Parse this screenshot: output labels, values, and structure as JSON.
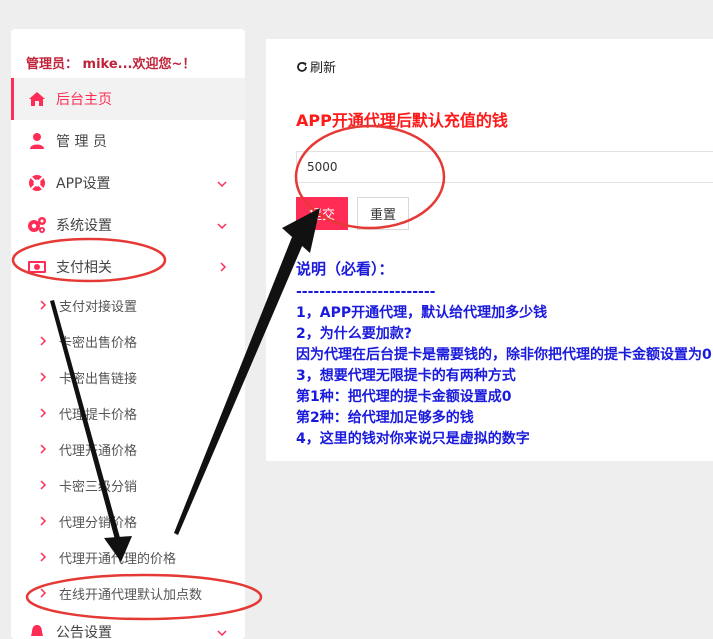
{
  "sidebar": {
    "admin_greeting": "管理员：  mike...欢迎您~！",
    "items": [
      {
        "label": "后台主页"
      },
      {
        "label": "管  理  员"
      },
      {
        "label": "APP设置"
      },
      {
        "label": "系统设置"
      },
      {
        "label": "支付相关"
      }
    ],
    "sub_items": [
      {
        "label": "支付对接设置"
      },
      {
        "label": "卡密出售价格"
      },
      {
        "label": "卡密出售链接"
      },
      {
        "label": "代理提卡价格"
      },
      {
        "label": "代理开通价格"
      },
      {
        "label": "卡密三级分销"
      },
      {
        "label": "代理分销价格"
      },
      {
        "label": "代理开通代理的价格"
      },
      {
        "label": "在线开通代理默认加点数"
      }
    ],
    "bottom_partial": "公告设置"
  },
  "main": {
    "refresh_label": "刷新",
    "field_title": "APP开通代理后默认充值的钱",
    "amount_value": "5000",
    "submit_label": "提交",
    "reset_label": "重置",
    "notes": [
      "说明（必看）：",
      "------------------------",
      "1，APP开通代理，默认给代理加多少钱",
      "2，为什么要加款?",
      "因为代理在后台提卡是需要钱的，除非你把代理的提卡金额设置为0",
      "3，想要代理无限提卡的有两种方式",
      "第1种：把代理的提卡金额设置成0",
      "第2种：给代理加足够多的钱",
      "4，这里的钱对你来说只是虚拟的数字"
    ]
  },
  "colors": {
    "accent": "#ff2d55",
    "title_red": "#ff1a1a",
    "notes_blue": "#1a1add",
    "annotation_red": "#e53935"
  }
}
